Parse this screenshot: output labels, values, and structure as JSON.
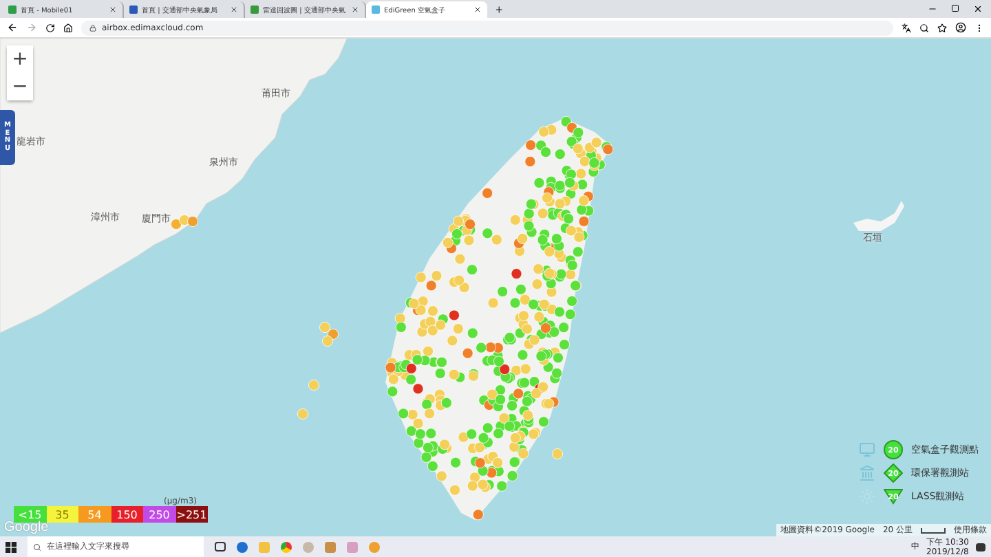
{
  "browser": {
    "tabs": [
      {
        "title": "首頁 - Mobile01",
        "selected": false,
        "color": "#2e9e48"
      },
      {
        "title": "首頁 | 交通部中央氣象局",
        "selected": false,
        "color": "#2a5ab8"
      },
      {
        "title": "雷達回波圖 | 交通部中央氣",
        "selected": false,
        "color": "#3a9a3a"
      },
      {
        "title": "EdiGreen 空氣盒子",
        "selected": true,
        "color": "#5bb8e0"
      }
    ],
    "new_tab": "+",
    "url": "airbox.edimaxcloud.com"
  },
  "map": {
    "zoom_in": "+",
    "zoom_out": "−",
    "menu": "MENU",
    "place_labels": [
      "莆田市",
      "龍岩市",
      "泉州市",
      "漳州市",
      "廈門市",
      "石垣"
    ],
    "legend": {
      "unit": "(μg/m3)",
      "levels": [
        {
          "label": "<15",
          "color": "#45e03c"
        },
        {
          "label": "35",
          "color": "#f4f43c"
        },
        {
          "label": "54",
          "color": "#f59a1e"
        },
        {
          "label": "150",
          "color": "#e8202a"
        },
        {
          "label": "250",
          "color": "#c24ae6"
        },
        {
          "label": ">251",
          "color": "#8c1010"
        }
      ]
    },
    "station_legend": [
      {
        "kind": "airbox",
        "badge": "20",
        "label": "空氣盒子觀測點"
      },
      {
        "kind": "epa",
        "badge": "20",
        "label": "環保署觀測站"
      },
      {
        "kind": "lass",
        "badge": "20",
        "label": "LASS觀測站"
      }
    ],
    "logo": "Google",
    "attribution": "地圖資料©2019 Google",
    "scale": "20 公里",
    "terms": "使用條款"
  },
  "taskbar": {
    "search_placeholder": "在這裡輸入文字來搜尋",
    "ime": "中",
    "time": "下午 10:30",
    "date": "2019/12/8"
  }
}
